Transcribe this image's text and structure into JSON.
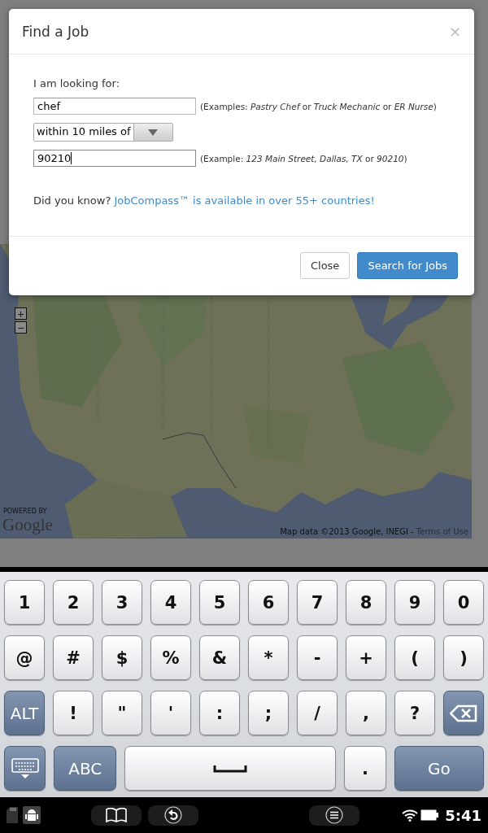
{
  "dialog": {
    "title": "Find a Job",
    "close": "×",
    "label": "I am looking for:",
    "keyword": {
      "value": "chef",
      "focused": false,
      "hint": "(Examples: *Pastry Chef* or *Truck Mechanic* or *ER Nurse*)"
    },
    "distance": {
      "value": "within 10 miles of"
    },
    "location": {
      "value": "90210",
      "focused": true,
      "hint": "(Example: *123 Main Street, Dallas, TX* or *90210*)"
    },
    "tip": {
      "text": "Did you know?",
      "link": "JobCompass™ is available in over 55+ countries!"
    },
    "buttons": [
      {
        "label": "Close",
        "kind": "default"
      },
      {
        "label": "Search for Jobs",
        "kind": "primary"
      }
    ]
  },
  "map": {
    "kind": "picture",
    "zoom": [
      "+",
      "−"
    ],
    "powered_by": "POWERED BY",
    "logo": "Google",
    "attribution": "Map data ©2013 Google, INEGI - ",
    "terms": "Terms of Use"
  },
  "keyboard": {
    "rows": [
      [
        {
          "kind": "char",
          "label": "1"
        },
        {
          "kind": "char",
          "label": "2"
        },
        {
          "kind": "char",
          "label": "3"
        },
        {
          "kind": "char",
          "label": "4"
        },
        {
          "kind": "char",
          "label": "5"
        },
        {
          "kind": "char",
          "label": "6"
        },
        {
          "kind": "char",
          "label": "7"
        },
        {
          "kind": "char",
          "label": "8"
        },
        {
          "kind": "char",
          "label": "9"
        },
        {
          "kind": "char",
          "label": "0"
        }
      ],
      [
        {
          "kind": "char",
          "label": "@"
        },
        {
          "kind": "char",
          "label": "#"
        },
        {
          "kind": "char",
          "label": "$"
        },
        {
          "kind": "char",
          "label": "%"
        },
        {
          "kind": "char",
          "label": "&"
        },
        {
          "kind": "char",
          "label": "*"
        },
        {
          "kind": "char",
          "label": "-"
        },
        {
          "kind": "char",
          "label": "+"
        },
        {
          "kind": "char",
          "label": "("
        },
        {
          "kind": "char",
          "label": ")"
        }
      ],
      [
        {
          "kind": "alt",
          "label": "ALT"
        },
        {
          "kind": "char",
          "label": "!"
        },
        {
          "kind": "char",
          "label": "\""
        },
        {
          "kind": "char",
          "label": "'"
        },
        {
          "kind": "char",
          "label": ":"
        },
        {
          "kind": "char",
          "label": ";"
        },
        {
          "kind": "char",
          "label": "/"
        },
        {
          "kind": "char",
          "label": ","
        },
        {
          "kind": "char",
          "label": "?"
        },
        {
          "kind": "backspace"
        }
      ]
    ],
    "bottom_row": [
      {
        "kind": "hide"
      },
      {
        "kind": "mode",
        "label": "ABC"
      },
      {
        "kind": "space"
      },
      {
        "kind": "char",
        "label": "."
      },
      {
        "kind": "action",
        "label": "Go"
      }
    ]
  },
  "status_bar": {
    "time": "5:41"
  }
}
